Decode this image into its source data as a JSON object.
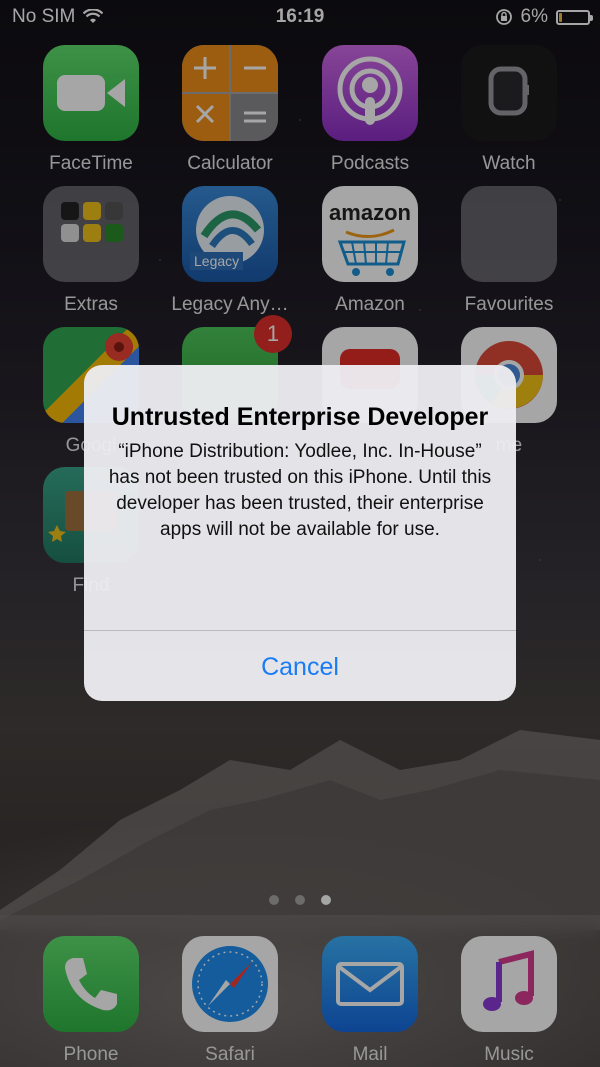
{
  "status_bar": {
    "carrier": "No SIM",
    "time": "16:19",
    "battery": "6%",
    "battery_level": 0.06
  },
  "apps": {
    "row1": [
      "FaceTime",
      "Calculator",
      "Podcasts",
      "Watch"
    ],
    "row2": [
      "Extras",
      "Legacy Any…",
      "Amazon",
      "Favourites"
    ],
    "row3": [
      "Googl",
      "",
      "",
      "me"
    ],
    "row4": [
      "Find"
    ],
    "legacy_icon_text": "Legacy",
    "amazon_icon_text": "amazon",
    "badge_count": "1"
  },
  "page_dots": {
    "count": 3,
    "active": 2
  },
  "dock": [
    "Phone",
    "Safari",
    "Mail",
    "Music"
  ],
  "alert": {
    "title": "Untrusted Enterprise Developer",
    "message": "“iPhone Distribution: Yodlee, Inc. In-House” has not been trusted on this iPhone. Until this developer has been trusted, their enterprise apps will not be available for use.",
    "cancel_label": "Cancel"
  }
}
